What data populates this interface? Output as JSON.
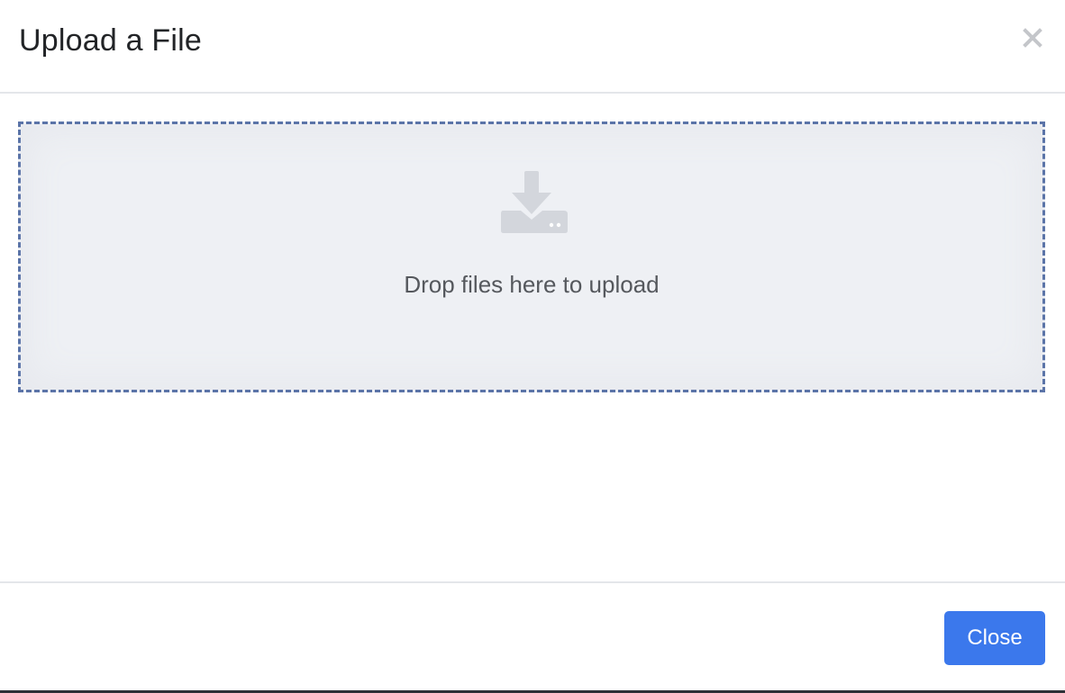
{
  "modal": {
    "title": "Upload a File",
    "close_icon": "close-x-icon"
  },
  "dropzone": {
    "icon": "download-tray-icon",
    "message": "Drop files here to upload"
  },
  "footer": {
    "close_label": "Close"
  },
  "colors": {
    "dropzone_border": "#5b74a8",
    "dropzone_background": "#eef0f4",
    "primary_button": "#3b78ec",
    "icon_gray": "#d3d6dc"
  }
}
